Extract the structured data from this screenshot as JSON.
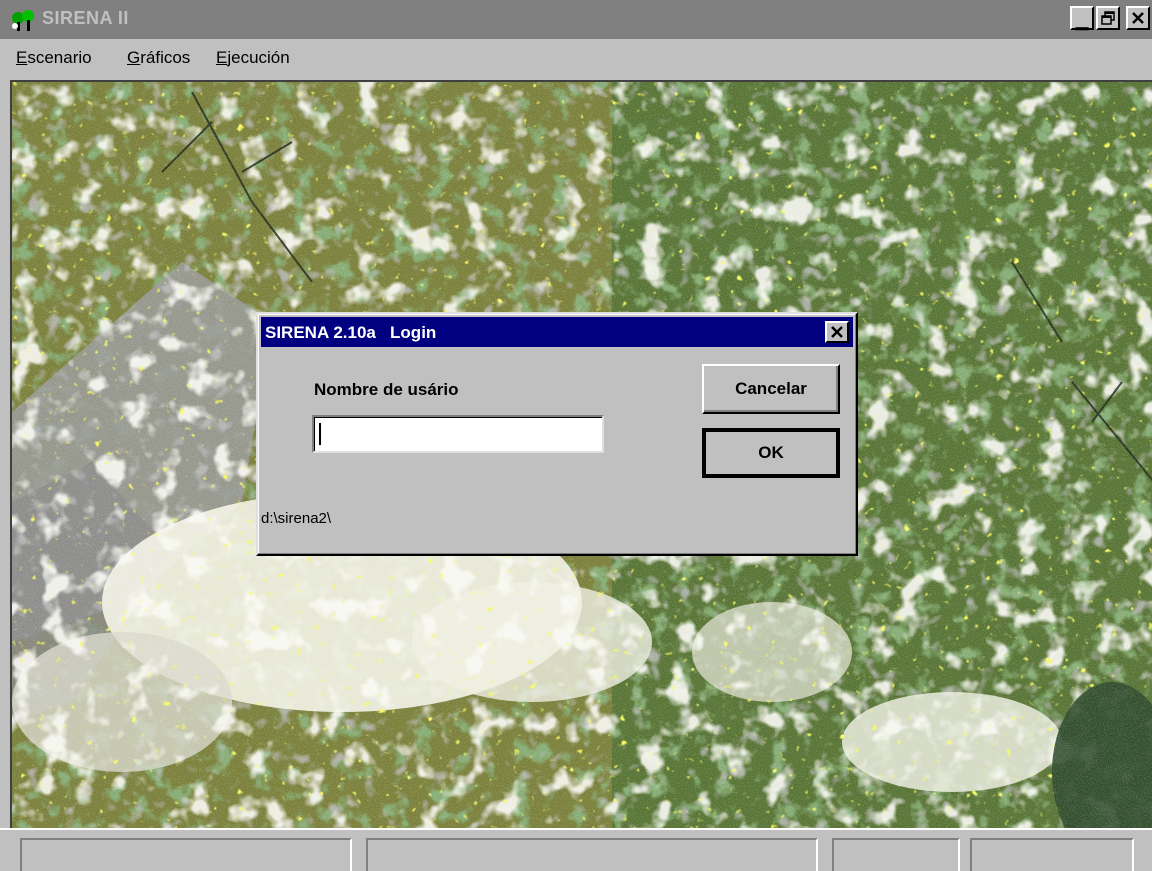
{
  "window": {
    "title": "SIRENA II",
    "minimize_glyph": "_",
    "restore_glyph": "🗗",
    "close_glyph": "✕"
  },
  "menu": {
    "items": [
      {
        "accel": "E",
        "rest": "scenario"
      },
      {
        "accel": "G",
        "rest": "ráficos"
      },
      {
        "accel": "E",
        "rest": "jecución"
      }
    ]
  },
  "dialog": {
    "title": "SIRENA 2.10a   Login",
    "close_glyph": "✕",
    "username_label": "Nombre de usário",
    "username_value": "",
    "cancel_label": "Cancelar",
    "ok_label": "OK",
    "path": "d:\\sirena2\\"
  },
  "colors": {
    "title_active": "#000080",
    "title_inactive": "#808080",
    "face": "#c0c0c0",
    "foliage_olive": "#7a7f3a",
    "foliage_green": "#3e6a2e",
    "sky_white": "#f4f4e8",
    "highlight_yellow": "#f2f21e"
  },
  "icons": {
    "app": "trees-icon"
  }
}
